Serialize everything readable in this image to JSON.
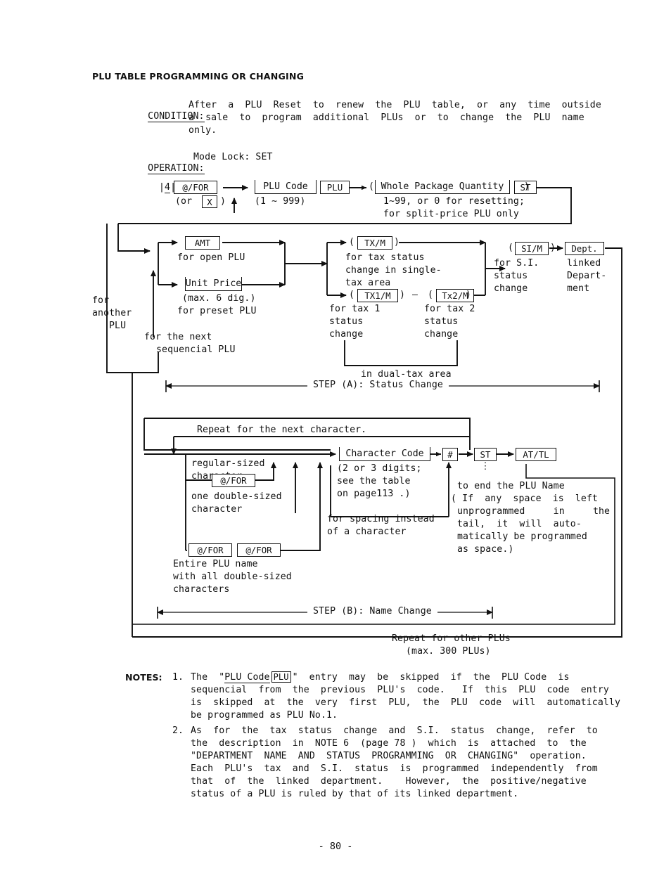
{
  "document": {
    "section_title": "PLU TABLE PROGRAMMING OR CHANGING",
    "footer_page": "-  80  -"
  },
  "condition": {
    "label": "CONDITION:",
    "line1": "After  a  PLU  Reset  to  renew  the  PLU  table,  or  any  time  outside",
    "line2": "a  sale  to  program  additional  PLUs  or  to  change  the  PLU  name",
    "line3": "only."
  },
  "operation": {
    "label": "OPERATION:",
    "value": "Mode Lock: SET"
  },
  "flow": {
    "row1": {
      "step_number": "4",
      "key_forx": "@/FOR",
      "or_text_open": "(or",
      "key_x": "X",
      "or_text_close": ")",
      "field_plu_code": "PLU Code",
      "plu_code_range": "(1 ~ 999)",
      "key_plu": "PLU",
      "paren_open": "(",
      "field_whole_package": "Whole Package Quantity",
      "key_st": "ST",
      "paren_close": ")",
      "note_line1": "1~99, or 0 for resetting;",
      "note_line2": "for split-price PLU only"
    },
    "row2": {
      "key_amt": "AMT",
      "amt_caption": "for open PLU",
      "field_unit_price": "Unit Price",
      "unit_price_max": "(max. 6 dig.)",
      "unit_price_caption": "for preset PLU",
      "for_another_plu": [
        "for",
        "another",
        "PLU"
      ],
      "for_next_sequencial": [
        "for the next",
        "sequencial PLU"
      ]
    },
    "tax": {
      "txm_paren_open": "(",
      "key_txm": "TX/M",
      "txm_paren_close": ")",
      "txm_caption": [
        "for tax status",
        "change in single-",
        "tax area"
      ],
      "tx1m_paren_open": "(",
      "key_tx1m": "TX1/M",
      "tx1m_paren_close": ")",
      "dash": "—",
      "tx2m_paren_open": "(",
      "key_tx2m": "Tx2/M",
      "tx2m_paren_close": ")",
      "tx1_caption": [
        "for tax 1",
        "status",
        "change"
      ],
      "tx2_caption": [
        "for tax 2",
        "status",
        "change"
      ],
      "dual_tax_caption": "in dual-tax area"
    },
    "si": {
      "paren_open": "(",
      "key_sim": "SI/M",
      "paren_close": ")",
      "caption": [
        "for S.I.",
        "status",
        "change"
      ],
      "key_dept": "Dept.",
      "dept_caption": [
        "linked",
        "Depart-",
        "ment"
      ]
    },
    "step_a": "STEP (A): Status Change",
    "step_b": "STEP (B): Name Change",
    "name_change": {
      "repeat_next_char": "Repeat for the next character.",
      "regular_caption": [
        "regular-sized",
        "character"
      ],
      "key_forx_single": "@/FOR",
      "double_caption": [
        "one double-sized",
        "character"
      ],
      "key_forx_a": "@/FOR",
      "key_forx_b": "@/FOR",
      "entire_caption": [
        "Entire PLU name",
        "with all double-sized",
        "characters"
      ],
      "field_character_code": "Character Code",
      "char_code_note": [
        "(2 or 3 digits;",
        "see the table",
        "on page113 .)"
      ],
      "key_hash": "#",
      "key_st": "ST",
      "key_attl": "AT/TL",
      "spacing_caption": [
        "for spacing instead",
        "of a character"
      ],
      "end_name_line": "to end the PLU Name",
      "end_name_paren": [
        "( If  any  space  is  left",
        "unprogrammed     in     the",
        "tail,  it  will  auto-",
        "matically be programmed",
        "as space.)"
      ],
      "dots": "⋮"
    },
    "repeat_other": [
      "Repeat for other PLUs",
      "(max. 300 PLUs)"
    ]
  },
  "notes": {
    "label": "NOTES:",
    "items": [
      {
        "num": "1.",
        "lines": [
          "The  \"|PLU Code| [PLU]\"  entry  may  be  skipped  if  the  PLU Code  is",
          "sequencial  from  the  previous  PLU's  code.   If  this  PLU  code  entry",
          "is  skipped  at  the  very  first  PLU,  the  PLU  code  will  automatically",
          "be programmed as PLU No.1."
        ]
      },
      {
        "num": "2.",
        "lines": [
          "As  for  the  tax  status  change  and  S.I.  status  change,  refer  to",
          "the  description  in  NOTE 6  (page 78 )  which  is  attached  to  the",
          "\"DEPARTMENT  NAME  AND  STATUS  PROGRAMMING  OR  CHANGING\"  operation.",
          "Each  PLU's  tax  and  S.I.  status  is  programmed  independently  from",
          "that  of  the  linked  department.    However,  the  positive/negative",
          "status of a PLU is ruled by that of its linked department."
        ]
      }
    ],
    "note1_inline": {
      "pre": "The  \"",
      "field": "PLU Code",
      "key": "PLU",
      "post": "\"  entry  may  be  skipped  if  the  PLU Code  is"
    }
  },
  "colors": {
    "ink": "#111111",
    "paper": "#ffffff"
  }
}
